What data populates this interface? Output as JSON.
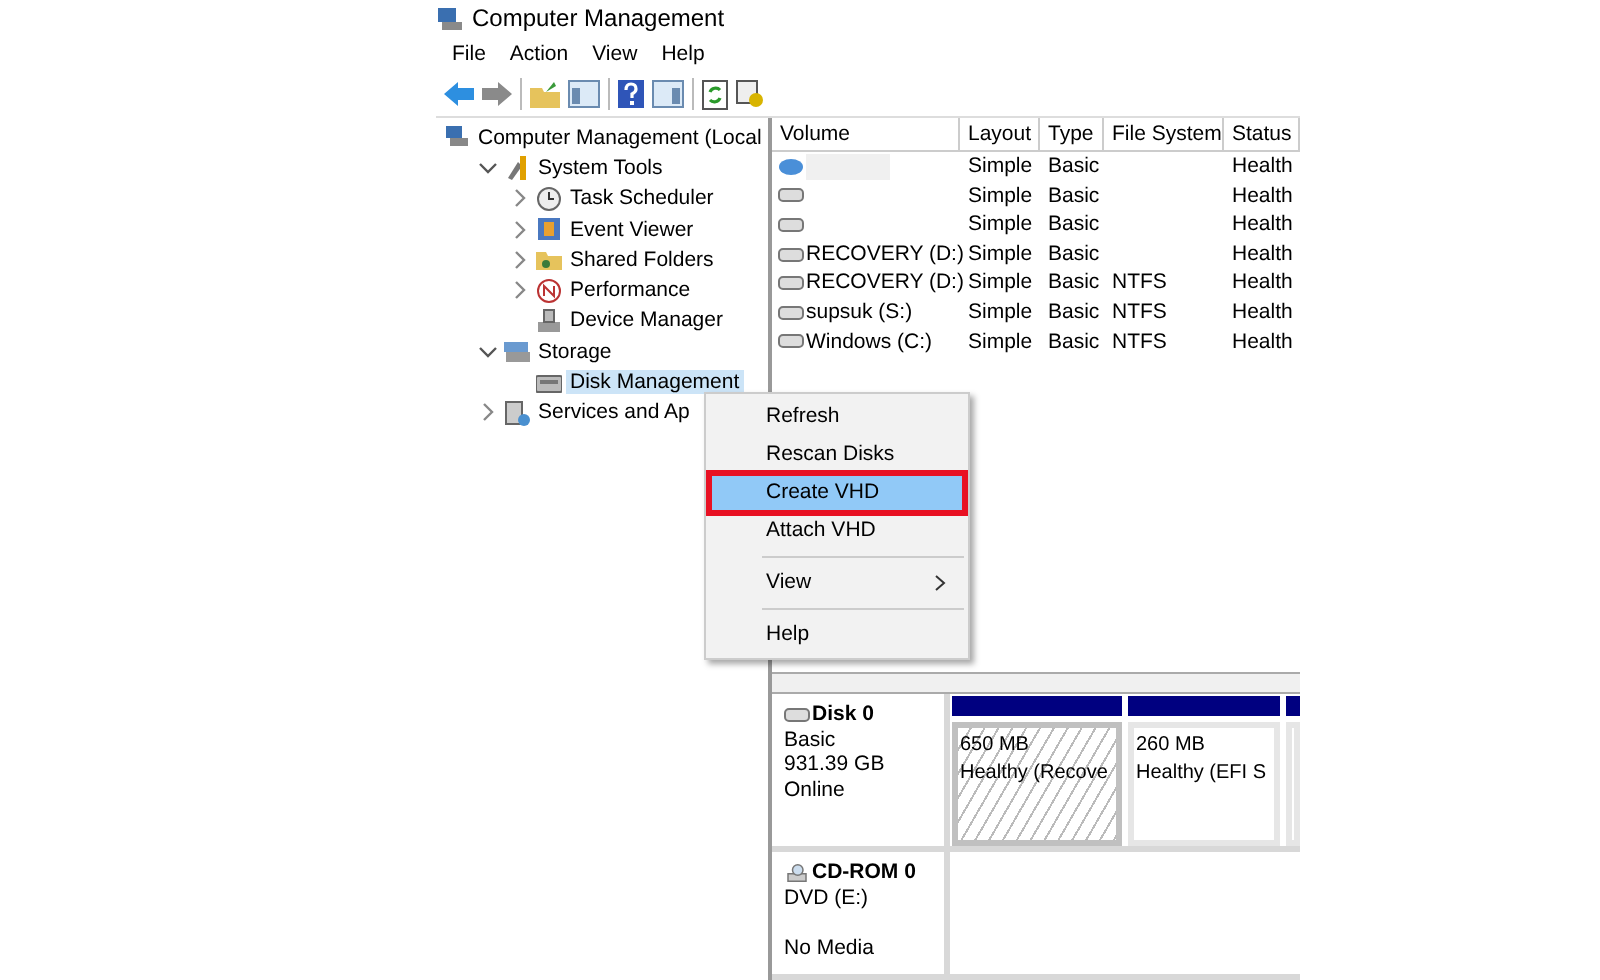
{
  "window": {
    "title": "Computer Management"
  },
  "menu_bar": [
    "File",
    "Action",
    "View",
    "Help"
  ],
  "tree": [
    {
      "label": "Computer Management (Local",
      "kind": "root",
      "selected": false,
      "children": [
        {
          "label": "System Tools",
          "kind": "branch",
          "expanded": true,
          "selected": false,
          "children": [
            {
              "label": "Task Scheduler",
              "kind": "branch",
              "expanded": false,
              "selected": false
            },
            {
              "label": "Event Viewer",
              "kind": "branch",
              "expanded": false,
              "selected": false
            },
            {
              "label": "Shared Folders",
              "kind": "branch",
              "expanded": false,
              "selected": false
            },
            {
              "label": "Performance",
              "kind": "branch",
              "expanded": false,
              "selected": false
            },
            {
              "label": "Device Manager",
              "kind": "leaf",
              "selected": false
            }
          ]
        },
        {
          "label": "Storage",
          "kind": "branch",
          "expanded": true,
          "selected": false,
          "children": [
            {
              "label": "Disk Management",
              "kind": "leaf",
              "selected": true
            }
          ]
        },
        {
          "label": "Services and Ap",
          "kind": "branch",
          "expanded": false,
          "selected": false
        }
      ]
    }
  ],
  "volumes": {
    "columns": [
      "Volume",
      "Layout",
      "Type",
      "File System",
      "Status"
    ],
    "rows": [
      {
        "kind": "redacted",
        "cells": [
          null,
          "Simple",
          "Basic",
          null,
          "Health"
        ]
      },
      {
        "kind": "volume",
        "cells": [
          null,
          "Simple",
          "Basic",
          null,
          "Health"
        ]
      },
      {
        "kind": "volume",
        "cells": [
          null,
          "Simple",
          "Basic",
          null,
          "Health"
        ]
      },
      {
        "kind": "volume",
        "cells": [
          "RECOVERY (D:)",
          "Simple",
          "Basic",
          null,
          "Health"
        ]
      },
      {
        "kind": "volume",
        "cells": [
          "RECOVERY (D:)",
          "Simple",
          "Basic",
          "NTFS",
          "Health"
        ]
      },
      {
        "kind": "volume",
        "cells": [
          "supsuk (S:)",
          "Simple",
          "Basic",
          "NTFS",
          "Health"
        ]
      },
      {
        "kind": "volume",
        "cells": [
          "Windows (C:)",
          "Simple",
          "Basic",
          "NTFS",
          "Health"
        ]
      }
    ]
  },
  "disks": [
    {
      "kind": "disk",
      "name": "Disk 0",
      "lines": [
        "Basic",
        "931.39 GB"
      ],
      "status": "Online",
      "partitions": [
        {
          "size": "650 MB",
          "status": "Healthy (Recove",
          "hatched": true
        },
        {
          "size": "260 MB",
          "status": "Healthy (EFI S",
          "hatched": false
        },
        {
          "hatched": false
        }
      ]
    },
    {
      "kind": "cdrom",
      "name": "CD-ROM 0",
      "lines": [
        "DVD (E:)"
      ],
      "status": "No Media"
    }
  ],
  "context_menu": [
    {
      "kind": "item",
      "label": "Refresh",
      "selected": false,
      "outlined": false,
      "submenu": false
    },
    {
      "kind": "item",
      "label": "Rescan Disks",
      "selected": false,
      "outlined": false,
      "submenu": false
    },
    {
      "kind": "item",
      "label": "Create VHD",
      "selected": true,
      "outlined": true,
      "submenu": false
    },
    {
      "kind": "item",
      "label": "Attach VHD",
      "selected": false,
      "outlined": false,
      "submenu": false
    },
    {
      "kind": "separator"
    },
    {
      "kind": "item",
      "label": "View",
      "selected": false,
      "outlined": false,
      "submenu": true
    },
    {
      "kind": "separator"
    },
    {
      "kind": "item",
      "label": "Help",
      "selected": false,
      "outlined": false,
      "submenu": false
    }
  ]
}
